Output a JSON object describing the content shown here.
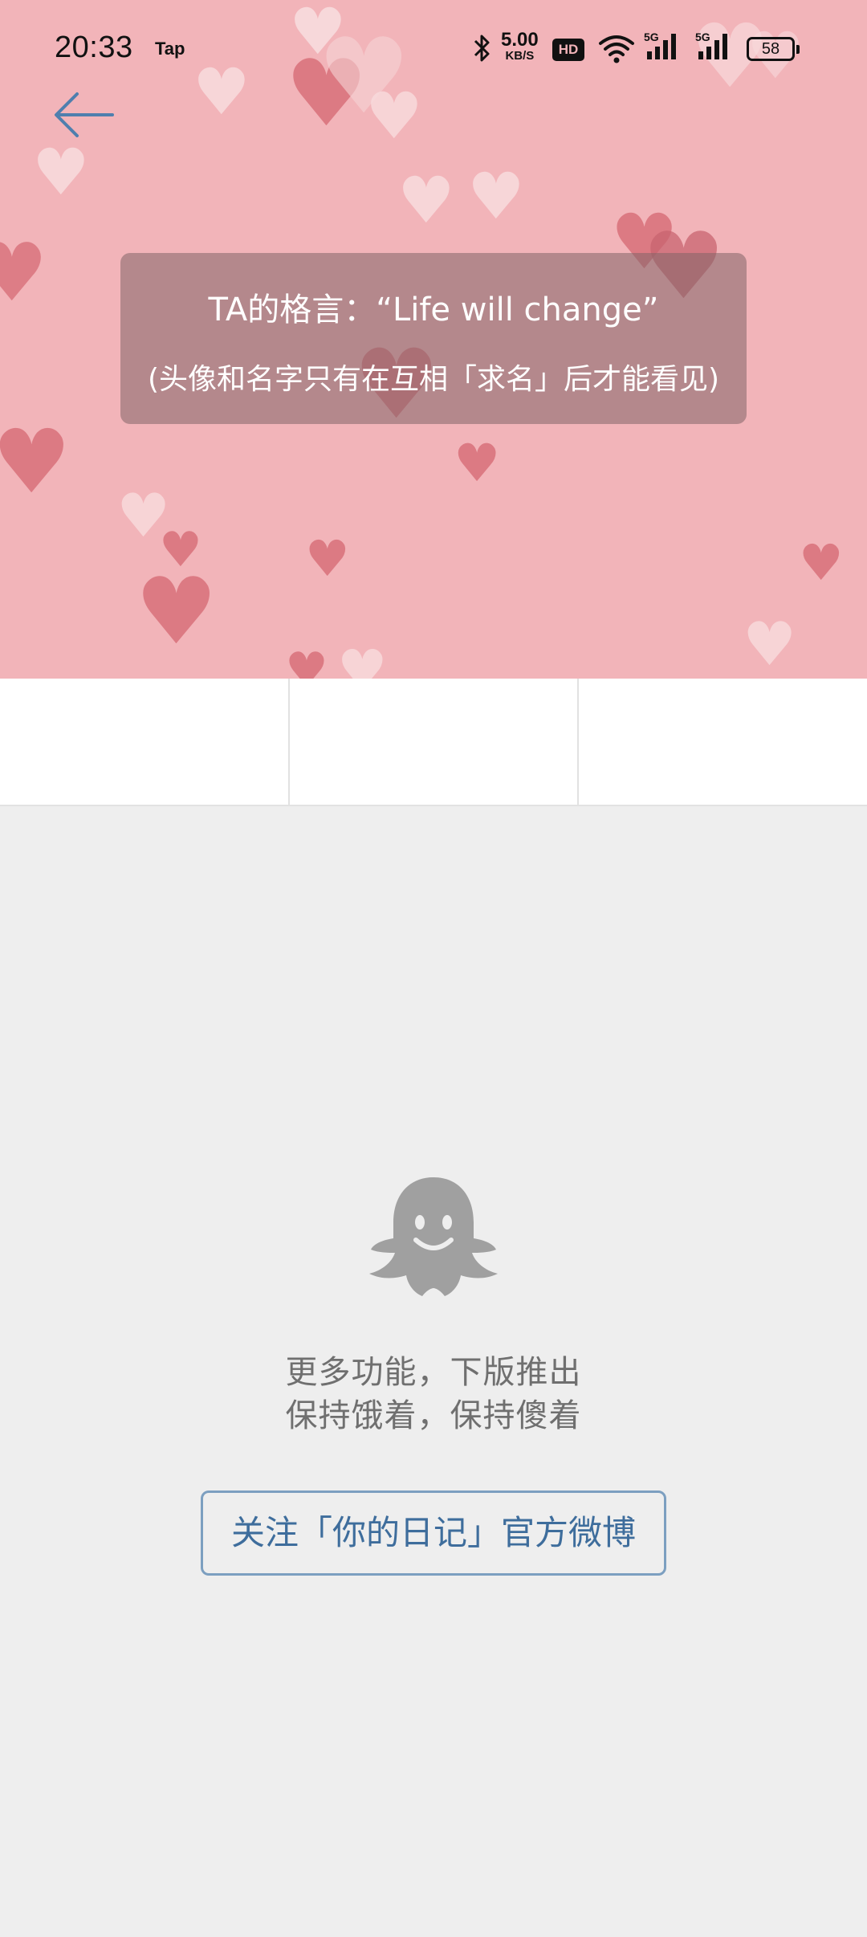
{
  "status_bar": {
    "time": "20:33",
    "app_label": "Tap",
    "speed_value": "5.00",
    "speed_unit": "KB/S",
    "hd_label": "HD",
    "network_1": "5G",
    "network_2": "5G",
    "battery_percent": "58"
  },
  "header": {
    "back_icon": "arrow-left-icon",
    "motto": "TA的格言：“Life will change”",
    "note": "(头像和名字只有在互相「求名」后才能看见)"
  },
  "tabs": [
    "",
    "",
    ""
  ],
  "empty_state": {
    "icon": "ghost-icon",
    "line1": "更多功能，下版推出",
    "line2": "保持饿着，保持傻着"
  },
  "follow_button": {
    "label": "关注「你的日记」官方微博"
  },
  "colors": {
    "hero_background": "#f2b4b9",
    "page_background": "#eeeeee",
    "accent_blue": "#3e6d9c",
    "ghost_gray": "#a0a0a0"
  }
}
